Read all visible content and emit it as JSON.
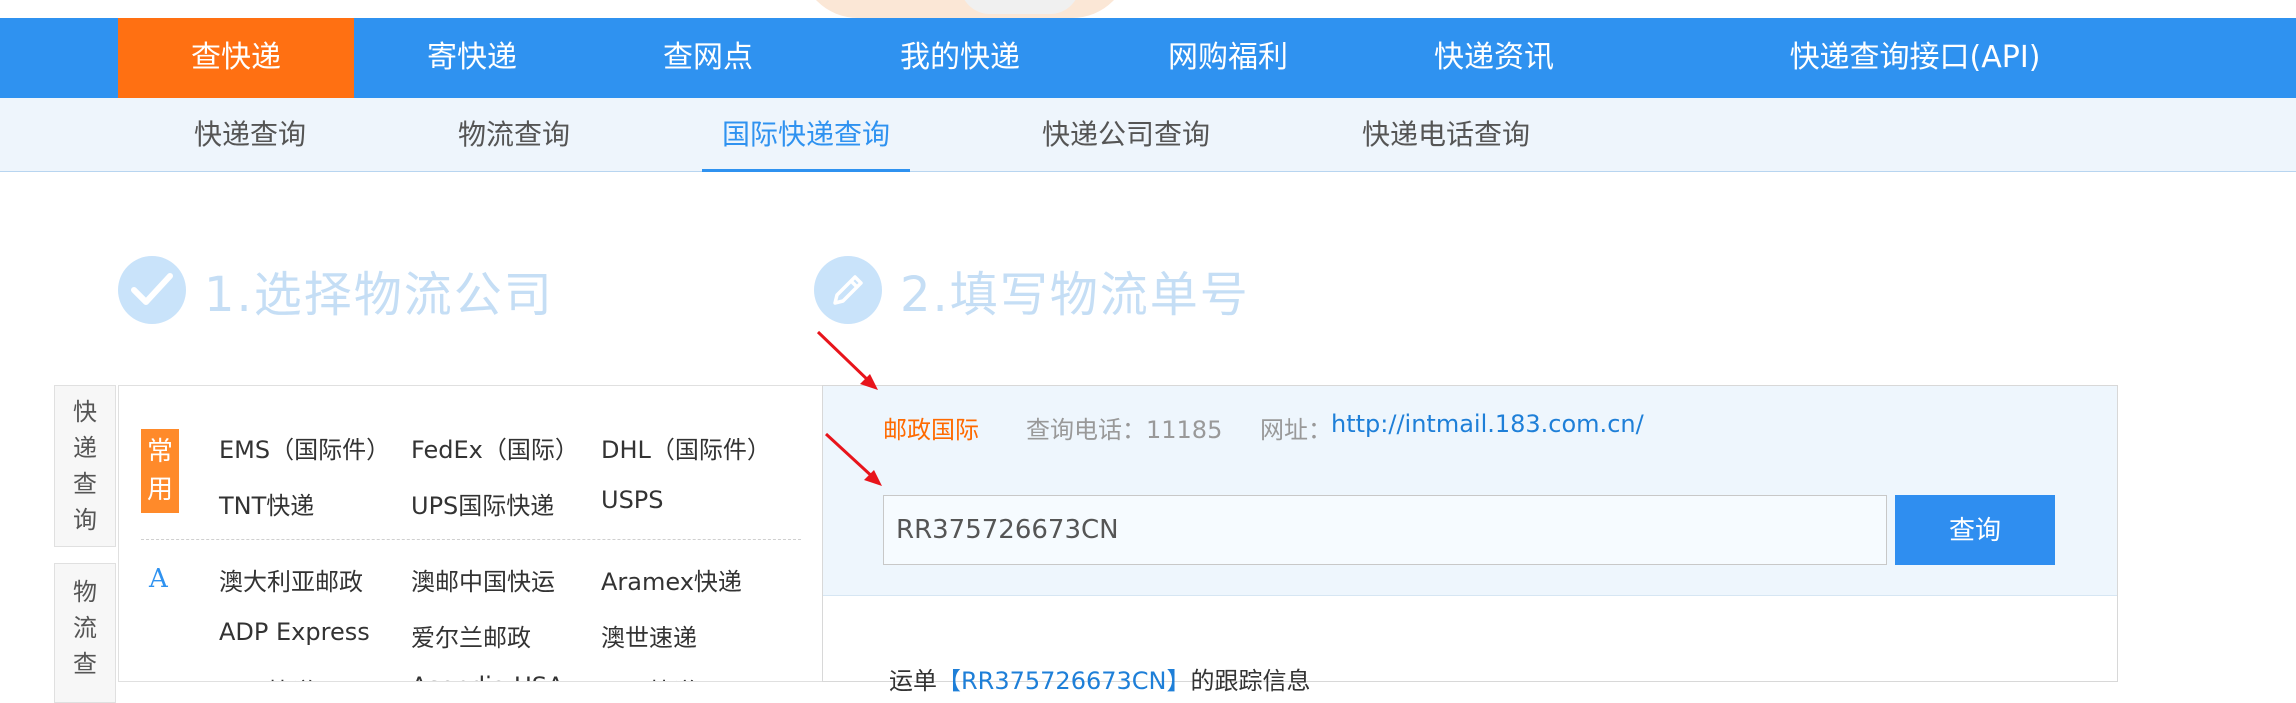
{
  "main_nav": [
    {
      "label": "查快递",
      "active": true
    },
    {
      "label": "寄快递",
      "active": false
    },
    {
      "label": "查网点",
      "active": false
    },
    {
      "label": "我的快递",
      "active": false
    },
    {
      "label": "网购福利",
      "active": false
    },
    {
      "label": "快递资讯",
      "active": false
    },
    {
      "label": "快递查询接口(API)",
      "active": false
    }
  ],
  "sub_nav": [
    {
      "label": "快递查询",
      "active": false
    },
    {
      "label": "物流查询",
      "active": false
    },
    {
      "label": "国际快递查询",
      "active": true
    },
    {
      "label": "快递公司查询",
      "active": false
    },
    {
      "label": "快递电话查询",
      "active": false
    }
  ],
  "steps": {
    "step1": "1.选择物流公司",
    "step2": "2.填写物流单号"
  },
  "side_tabs": {
    "tab1": [
      "快",
      "递",
      "查",
      "询"
    ],
    "tab2": [
      "物",
      "流",
      "查"
    ]
  },
  "companies": {
    "common_badge": [
      "常",
      "用"
    ],
    "common": [
      "EMS（国际件）",
      "FedEx（国际）",
      "DHL（国际件）",
      "TNT快递",
      "UPS国际快递",
      "USPS"
    ],
    "letter_a": "A",
    "a_list": [
      "澳大利亚邮政",
      "澳邮中国快运",
      "Aramex快递",
      "ADP Express",
      "爱尔兰邮政",
      "澳世速递",
      "AAE快递",
      "Asendia USA",
      "AOL快递"
    ]
  },
  "query": {
    "company_name": "邮政国际",
    "phone_label": "查询电话：11185",
    "site_label": "网址：",
    "site_url": "http://intmail.183.com.cn/",
    "tracking_number": "RR375726673CN",
    "query_button": "查询",
    "track_prefix": "运单",
    "track_number_display": "【RR375726673CN】",
    "track_suffix": "的跟踪信息"
  },
  "colors": {
    "nav_blue": "#2f92f0",
    "nav_active_orange": "#ff7012",
    "annotation_red": "#e8141b"
  }
}
